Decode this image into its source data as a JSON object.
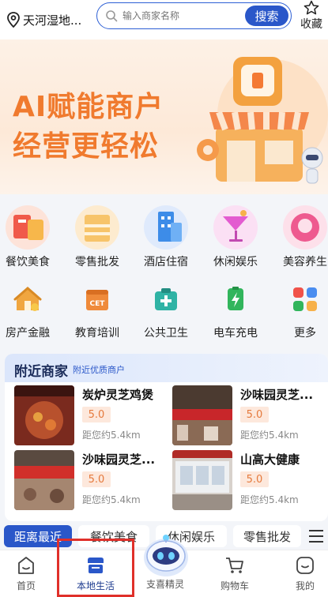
{
  "header": {
    "location": "天河湿地...",
    "search_placeholder": "输入商家名称",
    "search_button": "搜索",
    "favorite_label": "收藏"
  },
  "banner": {
    "line1": "AI赋能商户",
    "line2": "经营更轻松"
  },
  "categories_row1": [
    {
      "label": "餐饮美食",
      "icon": "food-icon",
      "color": "#f05a4a"
    },
    {
      "label": "零售批发",
      "icon": "retail-icon",
      "color": "#f7b14a"
    },
    {
      "label": "酒店住宿",
      "icon": "hotel-icon",
      "color": "#3d8ce8"
    },
    {
      "label": "休闲娱乐",
      "icon": "leisure-icon",
      "color": "#e35bd0"
    },
    {
      "label": "美容养生",
      "icon": "beauty-icon",
      "color": "#ee5a8f"
    }
  ],
  "categories_row2": [
    {
      "label": "房产金融",
      "icon": "house-icon",
      "color": "#f0a640"
    },
    {
      "label": "教育培训",
      "icon": "education-icon",
      "color": "#ef8a3a"
    },
    {
      "label": "公共卫生",
      "icon": "health-icon",
      "color": "#2fb3a5"
    },
    {
      "label": "电车充电",
      "icon": "charging-icon",
      "color": "#31b55c"
    },
    {
      "label": "更多",
      "icon": "more-icon",
      "color": "#4a8df0"
    }
  ],
  "nearby": {
    "title": "附近商家",
    "subtitle": "附近优质商户",
    "merchants": [
      {
        "name": "炭炉灵芝鸡煲",
        "score": "5.0",
        "distance": "距您约5.4km"
      },
      {
        "name": "沙味园灵芝...",
        "score": "5.0",
        "distance": "距您约5.4km"
      },
      {
        "name": "沙味园灵芝...",
        "score": "5.0",
        "distance": "距您约5.4km"
      },
      {
        "name": "山高大健康",
        "score": "5.0",
        "distance": "距您约5.4km"
      }
    ]
  },
  "filter_tabs": [
    "距离最近",
    "餐饮美食",
    "休闲娱乐",
    "零售批发"
  ],
  "bottom_nav": [
    {
      "label": "首页",
      "icon": "home-icon"
    },
    {
      "label": "本地生活",
      "icon": "store-icon"
    },
    {
      "label": "支喜精灵",
      "icon": "robot-icon"
    },
    {
      "label": "购物车",
      "icon": "cart-icon"
    },
    {
      "label": "我的",
      "icon": "profile-icon"
    }
  ],
  "colors": {
    "brand_blue": "#2a57c9",
    "accent_orange": "#f07a2e",
    "highlight_red": "#e0302a"
  }
}
